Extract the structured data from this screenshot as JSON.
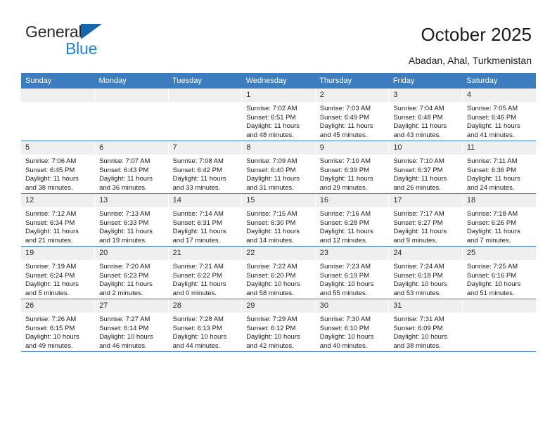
{
  "brand": {
    "name_top": "General",
    "name_bottom": "Blue",
    "triangle_color": "#1668ad",
    "blue_color": "#1f82d4"
  },
  "header": {
    "title": "October 2025",
    "location": "Abadan, Ahal, Turkmenistan"
  },
  "theme": {
    "header_row_bg": "#3b7dbf",
    "daynum_bg": "#efefef",
    "week_rule": "#3b7dbf"
  },
  "weekday_headers": [
    "Sunday",
    "Monday",
    "Tuesday",
    "Wednesday",
    "Thursday",
    "Friday",
    "Saturday"
  ],
  "weeks": [
    [
      {
        "day": ""
      },
      {
        "day": ""
      },
      {
        "day": ""
      },
      {
        "day": "1",
        "sunrise": "Sunrise: 7:02 AM",
        "sunset": "Sunset: 6:51 PM",
        "daylight1": "Daylight: 11 hours",
        "daylight2": "and 48 minutes."
      },
      {
        "day": "2",
        "sunrise": "Sunrise: 7:03 AM",
        "sunset": "Sunset: 6:49 PM",
        "daylight1": "Daylight: 11 hours",
        "daylight2": "and 45 minutes."
      },
      {
        "day": "3",
        "sunrise": "Sunrise: 7:04 AM",
        "sunset": "Sunset: 6:48 PM",
        "daylight1": "Daylight: 11 hours",
        "daylight2": "and 43 minutes."
      },
      {
        "day": "4",
        "sunrise": "Sunrise: 7:05 AM",
        "sunset": "Sunset: 6:46 PM",
        "daylight1": "Daylight: 11 hours",
        "daylight2": "and 41 minutes."
      }
    ],
    [
      {
        "day": "5",
        "sunrise": "Sunrise: 7:06 AM",
        "sunset": "Sunset: 6:45 PM",
        "daylight1": "Daylight: 11 hours",
        "daylight2": "and 38 minutes."
      },
      {
        "day": "6",
        "sunrise": "Sunrise: 7:07 AM",
        "sunset": "Sunset: 6:43 PM",
        "daylight1": "Daylight: 11 hours",
        "daylight2": "and 36 minutes."
      },
      {
        "day": "7",
        "sunrise": "Sunrise: 7:08 AM",
        "sunset": "Sunset: 6:42 PM",
        "daylight1": "Daylight: 11 hours",
        "daylight2": "and 33 minutes."
      },
      {
        "day": "8",
        "sunrise": "Sunrise: 7:09 AM",
        "sunset": "Sunset: 6:40 PM",
        "daylight1": "Daylight: 11 hours",
        "daylight2": "and 31 minutes."
      },
      {
        "day": "9",
        "sunrise": "Sunrise: 7:10 AM",
        "sunset": "Sunset: 6:39 PM",
        "daylight1": "Daylight: 11 hours",
        "daylight2": "and 29 minutes."
      },
      {
        "day": "10",
        "sunrise": "Sunrise: 7:10 AM",
        "sunset": "Sunset: 6:37 PM",
        "daylight1": "Daylight: 11 hours",
        "daylight2": "and 26 minutes."
      },
      {
        "day": "11",
        "sunrise": "Sunrise: 7:11 AM",
        "sunset": "Sunset: 6:36 PM",
        "daylight1": "Daylight: 11 hours",
        "daylight2": "and 24 minutes."
      }
    ],
    [
      {
        "day": "12",
        "sunrise": "Sunrise: 7:12 AM",
        "sunset": "Sunset: 6:34 PM",
        "daylight1": "Daylight: 11 hours",
        "daylight2": "and 21 minutes."
      },
      {
        "day": "13",
        "sunrise": "Sunrise: 7:13 AM",
        "sunset": "Sunset: 6:33 PM",
        "daylight1": "Daylight: 11 hours",
        "daylight2": "and 19 minutes."
      },
      {
        "day": "14",
        "sunrise": "Sunrise: 7:14 AM",
        "sunset": "Sunset: 6:31 PM",
        "daylight1": "Daylight: 11 hours",
        "daylight2": "and 17 minutes."
      },
      {
        "day": "15",
        "sunrise": "Sunrise: 7:15 AM",
        "sunset": "Sunset: 6:30 PM",
        "daylight1": "Daylight: 11 hours",
        "daylight2": "and 14 minutes."
      },
      {
        "day": "16",
        "sunrise": "Sunrise: 7:16 AM",
        "sunset": "Sunset: 6:28 PM",
        "daylight1": "Daylight: 11 hours",
        "daylight2": "and 12 minutes."
      },
      {
        "day": "17",
        "sunrise": "Sunrise: 7:17 AM",
        "sunset": "Sunset: 6:27 PM",
        "daylight1": "Daylight: 11 hours",
        "daylight2": "and 9 minutes."
      },
      {
        "day": "18",
        "sunrise": "Sunrise: 7:18 AM",
        "sunset": "Sunset: 6:26 PM",
        "daylight1": "Daylight: 11 hours",
        "daylight2": "and 7 minutes."
      }
    ],
    [
      {
        "day": "19",
        "sunrise": "Sunrise: 7:19 AM",
        "sunset": "Sunset: 6:24 PM",
        "daylight1": "Daylight: 11 hours",
        "daylight2": "and 5 minutes."
      },
      {
        "day": "20",
        "sunrise": "Sunrise: 7:20 AM",
        "sunset": "Sunset: 6:23 PM",
        "daylight1": "Daylight: 11 hours",
        "daylight2": "and 2 minutes."
      },
      {
        "day": "21",
        "sunrise": "Sunrise: 7:21 AM",
        "sunset": "Sunset: 6:22 PM",
        "daylight1": "Daylight: 11 hours",
        "daylight2": "and 0 minutes."
      },
      {
        "day": "22",
        "sunrise": "Sunrise: 7:22 AM",
        "sunset": "Sunset: 6:20 PM",
        "daylight1": "Daylight: 10 hours",
        "daylight2": "and 58 minutes."
      },
      {
        "day": "23",
        "sunrise": "Sunrise: 7:23 AM",
        "sunset": "Sunset: 6:19 PM",
        "daylight1": "Daylight: 10 hours",
        "daylight2": "and 55 minutes."
      },
      {
        "day": "24",
        "sunrise": "Sunrise: 7:24 AM",
        "sunset": "Sunset: 6:18 PM",
        "daylight1": "Daylight: 10 hours",
        "daylight2": "and 53 minutes."
      },
      {
        "day": "25",
        "sunrise": "Sunrise: 7:25 AM",
        "sunset": "Sunset: 6:16 PM",
        "daylight1": "Daylight: 10 hours",
        "daylight2": "and 51 minutes."
      }
    ],
    [
      {
        "day": "26",
        "sunrise": "Sunrise: 7:26 AM",
        "sunset": "Sunset: 6:15 PM",
        "daylight1": "Daylight: 10 hours",
        "daylight2": "and 49 minutes."
      },
      {
        "day": "27",
        "sunrise": "Sunrise: 7:27 AM",
        "sunset": "Sunset: 6:14 PM",
        "daylight1": "Daylight: 10 hours",
        "daylight2": "and 46 minutes."
      },
      {
        "day": "28",
        "sunrise": "Sunrise: 7:28 AM",
        "sunset": "Sunset: 6:13 PM",
        "daylight1": "Daylight: 10 hours",
        "daylight2": "and 44 minutes."
      },
      {
        "day": "29",
        "sunrise": "Sunrise: 7:29 AM",
        "sunset": "Sunset: 6:12 PM",
        "daylight1": "Daylight: 10 hours",
        "daylight2": "and 42 minutes."
      },
      {
        "day": "30",
        "sunrise": "Sunrise: 7:30 AM",
        "sunset": "Sunset: 6:10 PM",
        "daylight1": "Daylight: 10 hours",
        "daylight2": "and 40 minutes."
      },
      {
        "day": "31",
        "sunrise": "Sunrise: 7:31 AM",
        "sunset": "Sunset: 6:09 PM",
        "daylight1": "Daylight: 10 hours",
        "daylight2": "and 38 minutes."
      },
      {
        "day": ""
      }
    ]
  ]
}
